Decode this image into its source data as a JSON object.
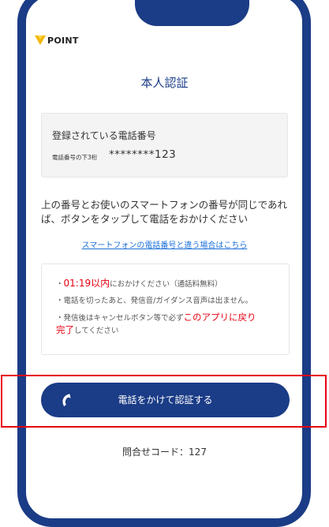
{
  "brand": {
    "label": "POINT",
    "icon": "y-mark-icon",
    "icon_color": "#f5b800"
  },
  "title": "本人認証",
  "registered": {
    "heading": "登録されている電話番号",
    "digits_label": "電話番号の下3桁",
    "digits_value": "********123"
  },
  "instruction": "上の番号とお使いのスマートフォンの番号が同じであれば、ボタンをタップして電話をおかけください",
  "link_text": "スマートフォンの電話番号と違う場合はこちら",
  "notes": {
    "n1_prefix": "・",
    "n1_emph": "01:19以内",
    "n1_suffix": "におかけください（通話料無料）",
    "n2": "・電話を切ったあと、発信音/ガイダンス音声は出ません。",
    "n3_prefix": "・発信後はキャンセルボタン等で必ず",
    "n3_emph1": "このアプリに戻り",
    "n3_emph2": "完了",
    "n3_suffix": "してください"
  },
  "call_button": {
    "label": "電話をかけて認証する",
    "icon": "phone-icon"
  },
  "inquiry": "問合せコード：127",
  "colors": {
    "primary": "#1b3c86",
    "emphasis": "#e60012",
    "link": "#1a6ed8"
  }
}
